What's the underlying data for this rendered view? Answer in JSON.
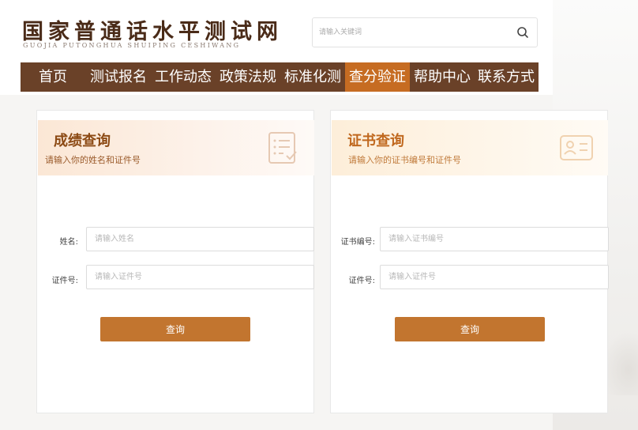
{
  "site": {
    "title": "国家普通话水平测试网",
    "subtitle": "GUOJIA PUTONGHUA SHUIPING CESHIWANG"
  },
  "search": {
    "placeholder": "请输入关键词",
    "icon": "search-icon"
  },
  "nav": {
    "items": [
      {
        "label": "首页",
        "active": false
      },
      {
        "label": "测试报名",
        "active": false
      },
      {
        "label": "工作动态",
        "active": false
      },
      {
        "label": "政策法规",
        "active": false
      },
      {
        "label": "标准化测",
        "active": false
      },
      {
        "label": "查分验证",
        "active": true
      },
      {
        "label": "帮助中心",
        "active": false
      },
      {
        "label": "联系方式",
        "active": false
      }
    ],
    "active_color": "#c66c22",
    "bar_color": "#6a4128"
  },
  "score_query": {
    "title": "成绩查询",
    "subtitle": "请输入你的姓名和证件号",
    "icon": "checklist-document-icon",
    "fields": [
      {
        "label": "姓名:",
        "placeholder": "请输入姓名"
      },
      {
        "label": "证件号:",
        "placeholder": "请输入证件号"
      }
    ],
    "button_label": "查询",
    "title_color": "#8c4a14"
  },
  "cert_query": {
    "title": "证书查询",
    "subtitle": "请输入你的证书编号和证件号",
    "icon": "id-card-icon",
    "fields": [
      {
        "label": "证书编号:",
        "placeholder": "请输入证书编号"
      },
      {
        "label": "证件号:",
        "placeholder": "请输入证件号"
      }
    ],
    "button_label": "查询",
    "title_color": "#c0681e"
  },
  "colors": {
    "brand_brown": "#4a2b18",
    "button": "#c2752f"
  }
}
